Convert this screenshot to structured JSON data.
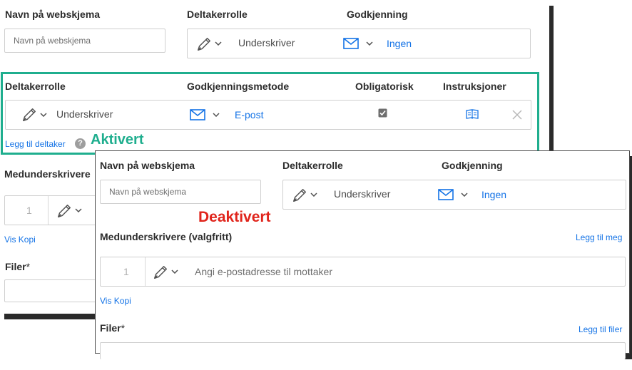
{
  "back": {
    "form_name_label": "Navn på webskjema",
    "form_name_placeholder": "Navn på webskjema",
    "role_label": "Deltakerrolle",
    "auth_label": "Godkjenning",
    "role_value": "Underskriver",
    "auth_value": "Ingen",
    "cosigners_label": "Medunderskrivere",
    "row_number": "1",
    "show_copy": "Vis Kopi",
    "files_label": "Filer",
    "required_mark": "*"
  },
  "participant_row": {
    "headers": {
      "role": "Deltakerrolle",
      "auth_method": "Godkjenningsmetode",
      "required": "Obligatorisk",
      "instructions": "Instruksjoner"
    },
    "role_value": "Underskriver",
    "auth_value": "E-post",
    "required_checked": true,
    "add_participant": "Legg til deltaker",
    "help_glyph": "?"
  },
  "annotations": {
    "enabled": "Aktivert",
    "enabled_color": "#1fae8e",
    "disabled": "Deaktivert",
    "disabled_color": "#e0241b"
  },
  "front": {
    "form_name_label": "Navn på webskjema",
    "form_name_placeholder": "Navn på webskjema",
    "role_label": "Deltakerrolle",
    "auth_label": "Godkjenning",
    "role_value": "Underskriver",
    "auth_value": "Ingen",
    "cosigners_label": "Medunderskrivere (valgfritt)",
    "add_me": "Legg til meg",
    "row_number": "1",
    "email_placeholder": "Angi e-postadresse til mottaker",
    "show_copy": "Vis Kopi",
    "files_label": "Filer",
    "required_mark": "*",
    "add_files": "Legg til filer"
  },
  "icons": {
    "pen": "pen-icon",
    "chevron": "chevron-down-icon",
    "mail": "mail-icon",
    "checkbox": "checkbox-icon",
    "book": "book-icon",
    "close": "close-icon",
    "help": "help-icon"
  },
  "colors": {
    "link": "#1473e6",
    "label": "#2c2c2c"
  }
}
